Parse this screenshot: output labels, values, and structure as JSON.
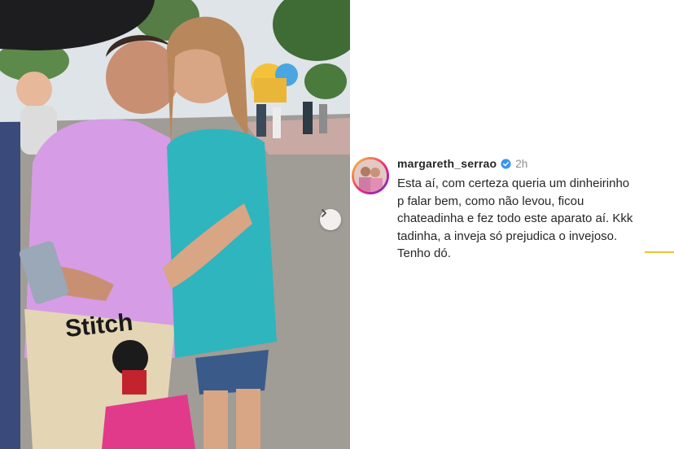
{
  "post": {
    "image_alt": "Two women hugging and smiling at a theme park",
    "shirt_text": "Stitch"
  },
  "comment": {
    "username": "margareth_serrao",
    "time": "2h",
    "text": "Esta aí, com certeza queria um dinheirinho\np falar bem, como não levou, ficou\nchateadinha e fez todo este aparato aí. Kkk\ntadinha, a inveja só prejudica o invejoso.\nTenho dó."
  },
  "icons": {
    "verified": "verified-badge-icon",
    "carousel": "chevron-right-icon"
  },
  "colors": {
    "verified": "#3897f0",
    "accent": "#f2c232",
    "text": "#262626",
    "muted": "#8e8e8e"
  }
}
